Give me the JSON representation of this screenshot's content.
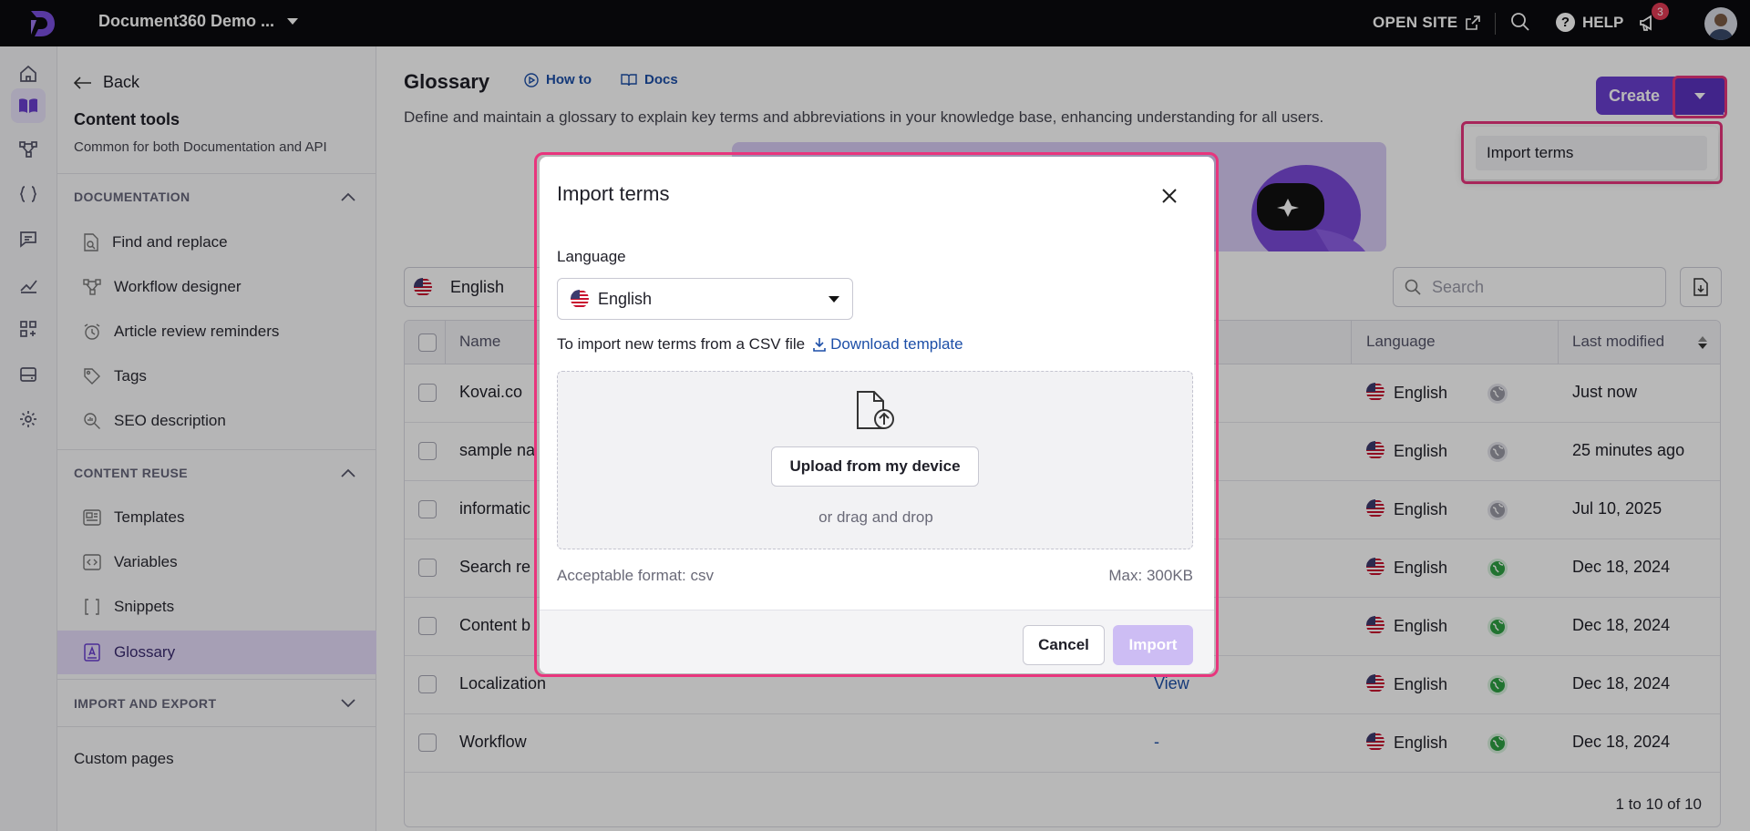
{
  "topbar": {
    "project_name": "Document360 Demo ...",
    "open_site": "OPEN SITE",
    "help": "HELP",
    "notification_count": "3"
  },
  "rail": {
    "icons": [
      "home-icon",
      "book-icon",
      "workflow-icon",
      "api-icon",
      "feedback-icon",
      "analytics-icon",
      "apps-icon",
      "drive-icon",
      "settings-icon"
    ],
    "active": "book-icon"
  },
  "sidenav": {
    "back": "Back",
    "title": "Content tools",
    "subtitle": "Common for both Documentation and API",
    "sections": [
      {
        "label": "DOCUMENTATION",
        "items": [
          "Find and replace",
          "Workflow designer",
          "Article review reminders",
          "Tags",
          "SEO description"
        ]
      },
      {
        "label": "CONTENT REUSE",
        "items": [
          "Templates",
          "Variables",
          "Snippets",
          "Glossary"
        ]
      },
      {
        "label": "IMPORT AND EXPORT",
        "items": []
      }
    ],
    "active_item": "Glossary",
    "custom_pages": "Custom pages"
  },
  "main": {
    "title": "Glossary",
    "how_to": "How to",
    "docs": "Docs",
    "description": "Define and maintain a glossary to explain key terms and abbreviations in your knowledge base, enhancing understanding for all users.",
    "create": "Create",
    "dropdown_item": "Import terms",
    "language": "English",
    "search_placeholder": "Search",
    "columns": [
      "Name",
      "Language",
      "Last modified"
    ],
    "rows": [
      {
        "name": "Kovai.co",
        "usage": "",
        "language": "English",
        "modified": "Just now",
        "status": "gray"
      },
      {
        "name": "sample na",
        "usage": "",
        "language": "English",
        "modified": "25 minutes ago",
        "status": "gray"
      },
      {
        "name": "informatic",
        "usage": "",
        "language": "English",
        "modified": "Jul 10, 2025",
        "status": "gray"
      },
      {
        "name": "Search re",
        "usage": "",
        "language": "English",
        "modified": "Dec 18, 2024",
        "status": "green"
      },
      {
        "name": "Content b",
        "usage": "",
        "language": "English",
        "modified": "Dec 18, 2024",
        "status": "green"
      },
      {
        "name": "Localization",
        "usage": "View",
        "language": "English",
        "modified": "Dec 18, 2024",
        "status": "green"
      },
      {
        "name": "Workflow",
        "usage": "-",
        "language": "English",
        "modified": "Dec 18, 2024",
        "status": "green"
      }
    ],
    "pager": "1 to 10 of 10"
  },
  "modal": {
    "title": "Import terms",
    "language_label": "Language",
    "language_value": "English",
    "import_text": "To import new terms from a CSV file",
    "download_template": "Download template",
    "upload_button": "Upload from my device",
    "drag_text": "or drag and drop",
    "format": "Acceptable format: csv",
    "max": "Max: 300KB",
    "cancel": "Cancel",
    "import": "Import"
  },
  "colors": {
    "accent": "#6a3fd0",
    "highlight": "#e8357d",
    "link": "#1d4fa8",
    "active_nav": "#e6ddfb",
    "status_green": "#2ea043"
  }
}
